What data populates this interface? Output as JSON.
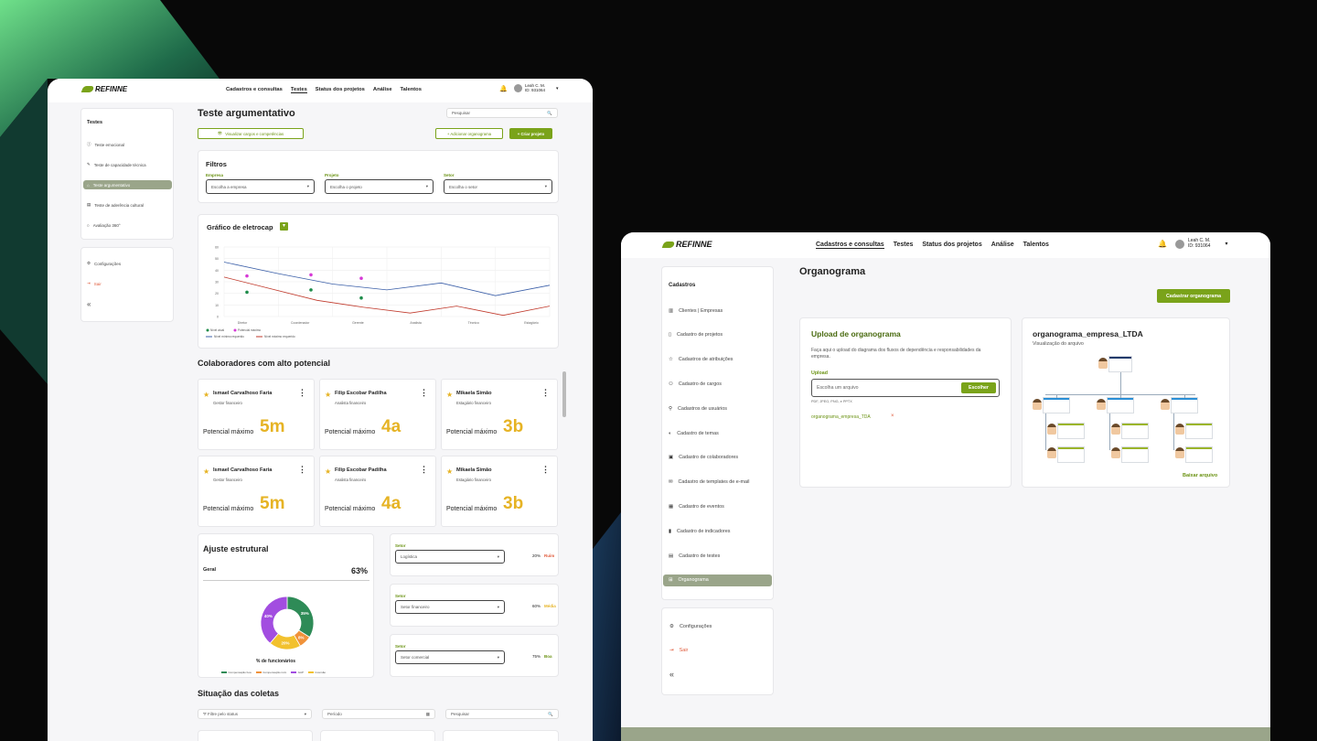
{
  "brand": {
    "logo_text": "REFINNE"
  },
  "colors": {
    "accent": "#7aa31a",
    "potential": "#e6b324",
    "background": "#080808"
  },
  "left_window": {
    "nav": {
      "items": [
        "Cadastros e consultas",
        "Testes",
        "Status dos projetos",
        "Análise",
        "Talentos"
      ],
      "active": "Testes"
    },
    "user": {
      "name": "Leah C. M.",
      "id": "ID: 931064"
    },
    "sidebar": {
      "title": "Testes",
      "items": [
        {
          "label": "Teste emocional",
          "icon": "info-icon"
        },
        {
          "label": "Teste de capacidade técnica",
          "icon": "pencil-icon"
        },
        {
          "label": "Teste argumentativo",
          "icon": "home-icon",
          "selected": true
        },
        {
          "label": "Teste de aderência cultural",
          "icon": "document-icon"
        },
        {
          "label": "Avaliação 360°",
          "icon": "circle-icon"
        }
      ],
      "bottom": {
        "settings": "Configurações",
        "logout": "Sair",
        "collapse": "«"
      }
    },
    "page_title": "Teste argumentativo",
    "search_placeholder": "Pesquisar",
    "buttons": {
      "view_roles": "Visualizar cargos e competências",
      "add_org": "+ Adicionar organograma",
      "create_project": "+ Criar projeto"
    },
    "filters": {
      "title": "Filtros",
      "fields": [
        {
          "label": "Empresa",
          "placeholder": "Escolha a empresa"
        },
        {
          "label": "Projeto",
          "placeholder": "Escolha o projeto"
        },
        {
          "label": "Setor",
          "placeholder": "Escolha o setor"
        }
      ]
    },
    "chart_title": "Gráfico de eletrocap",
    "high_potential_title": "Colaboradores com alto potencial",
    "potential_label": "Potencial máximo",
    "people": [
      {
        "name": "Ismael Carvalhoso Faria",
        "role": "Gestor financeiro",
        "value": "5m"
      },
      {
        "name": "Filip Escobar Padilha",
        "role": "Analista financeiro",
        "value": "4a"
      },
      {
        "name": "Mikaela Simão",
        "role": "Estagiário financeiro",
        "value": "3b"
      },
      {
        "name": "Ismael Carvalhoso Faria",
        "role": "Gestor financeiro",
        "value": "5m"
      },
      {
        "name": "Filip Escobar Padilha",
        "role": "Analista financeiro",
        "value": "4a"
      },
      {
        "name": "Mikaela Simão",
        "role": "Estagiário financeiro",
        "value": "3b"
      }
    ],
    "structural": {
      "title": "Ajuste estrutural",
      "general_label": "Geral",
      "general_value": "63%",
      "donut_caption": "% de funcionários",
      "sectors": [
        {
          "label": "Setor",
          "value": "Logística",
          "pct": "20%",
          "status": "Ruim",
          "status_color": "#e05a3a"
        },
        {
          "label": "Setor",
          "value": "Setor financeiro",
          "pct": "60%",
          "status": "Média",
          "status_color": "#e6b324"
        },
        {
          "label": "Setor",
          "value": "Setor comercial",
          "pct": "75%",
          "status": "Boa",
          "status_color": "#6a9212"
        }
      ]
    },
    "collections": {
      "title": "Situação das coletas",
      "filter_status": "Filtre pelo status",
      "period": "Período",
      "search": "Pesquisar"
    }
  },
  "right_window": {
    "nav": {
      "items": [
        "Cadastros e consultas",
        "Testes",
        "Status dos projetos",
        "Análise",
        "Talentos"
      ],
      "active": "Cadastros e consultas"
    },
    "user": {
      "name": "Leah C. M.",
      "id": "ID: 931064"
    },
    "sidebar": {
      "title": "Cadastros",
      "items": [
        {
          "label": "Clientes | Empresas",
          "icon": "building-icon"
        },
        {
          "label": "Cadastro de projetos",
          "icon": "file-icon"
        },
        {
          "label": "Cadastros de atribuições",
          "icon": "star-icon"
        },
        {
          "label": "Cadastro de cargos",
          "icon": "users-icon"
        },
        {
          "label": "Cadastros de usuários",
          "icon": "user-add-icon"
        },
        {
          "label": "Cadastro de temas",
          "icon": "palette-icon"
        },
        {
          "label": "Cadastro de colaboradores",
          "icon": "badge-icon"
        },
        {
          "label": "Cadastro de templates de e-mail",
          "icon": "mail-icon"
        },
        {
          "label": "Cadastro de eventos",
          "icon": "calendar-icon"
        },
        {
          "label": "Cadastro de indicadores",
          "icon": "bar-chart-icon"
        },
        {
          "label": "Cadastro de testes",
          "icon": "test-file-icon"
        },
        {
          "label": "Organograma",
          "icon": "org-chart-icon",
          "selected": true
        }
      ],
      "bottom": {
        "settings": "Configurações",
        "logout": "Sair",
        "collapse": "«"
      }
    },
    "page_title": "Organograma",
    "register_button": "Cadastrar organograma",
    "upload": {
      "title": "Upload de organograma",
      "description": "Faça aqui o upload do diagrama dos fluxos de dependência e responsabilidades da empresa.",
      "field_label": "Upload",
      "placeholder": "Escolha um arquivo",
      "choose_button": "Escolher",
      "formats": "PDF, JPEG, PNG, e PPTX",
      "file_name": "organograma_empresa_TDA"
    },
    "preview": {
      "title": "organograma_empresa_LTDA",
      "subtitle": "Visualização do arquivo",
      "download": "Baixar arquivo"
    }
  },
  "chart_data": {
    "type": "line",
    "categories": [
      "Diretor",
      "Coordenador",
      "Gerente",
      "Analista",
      "Técnico",
      "Estagiário"
    ],
    "ylim": [
      0,
      60
    ],
    "yticks": [
      0,
      10,
      20,
      30,
      40,
      50,
      60
    ],
    "series": [
      {
        "name": "Nível mínimo requerido",
        "color": "#3b5fa8",
        "values": [
          47,
          37,
          28,
          23,
          29,
          18,
          27
        ]
      },
      {
        "name": "Nível máximo requerido",
        "color": "#c0392b",
        "values": [
          34,
          24,
          14,
          8,
          3,
          9,
          1,
          9
        ]
      }
    ],
    "points": [
      {
        "name": "Nível atual",
        "color": "#1e8c4a",
        "points": [
          [
            0,
            21
          ],
          [
            1,
            23
          ],
          [
            2,
            16
          ]
        ]
      },
      {
        "name": "Potencial máximo",
        "color": "#d63ad6",
        "points": [
          [
            0,
            35
          ],
          [
            1,
            36
          ],
          [
            2,
            33
          ]
        ]
      }
    ],
    "legend": [
      "Nível atual",
      "Potencial máximo",
      "Nível mínimo requerido",
      "Nível máximo requerido"
    ],
    "donut": {
      "slices": [
        {
          "label": "Compensação boa",
          "value": 35,
          "color": "#2e8b57"
        },
        {
          "label": "Compensação ruim",
          "value": 8,
          "color": "#f0923a"
        },
        {
          "label": "GAP",
          "value": 40,
          "color": "#a24de0"
        },
        {
          "label": "Inversão",
          "value": 20,
          "color": "#f2c12e"
        }
      ],
      "labels": [
        "35%",
        "8%",
        "20%",
        "40%"
      ]
    }
  }
}
